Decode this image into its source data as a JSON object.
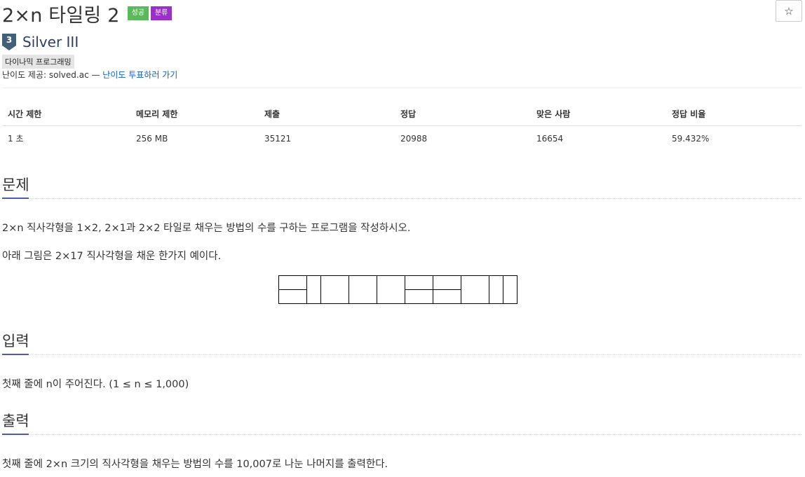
{
  "problem": {
    "title": "2×n 타일링 2",
    "badges": [
      "성공",
      "분류"
    ],
    "tier": "Silver III",
    "tier_number": "3",
    "tag": "다이나믹 프로그래밍",
    "provider_prefix": "난이도 제공: solved.ac — ",
    "provider_link": "난이도 투표하러 가기",
    "star_icon": "☆"
  },
  "stats": {
    "headers": [
      "시간 제한",
      "메모리 제한",
      "제출",
      "정답",
      "맞은 사람",
      "정답 비율"
    ],
    "values": [
      "1 초",
      "256 MB",
      "35121",
      "20988",
      "16654",
      "59.432%"
    ]
  },
  "sections": {
    "problem_heading": "문제",
    "problem_text_1": "2×n 직사각형을 1×2, 2×1과 2×2 타일로 채우는 방법의 수를 구하는 프로그램을 작성하시오.",
    "problem_text_2": "아래 그림은 2×17 직사각형을 채운 한가지 예이다.",
    "input_heading": "입력",
    "input_text": "첫째 줄에 n이 주어진다. (1 ≤ n ≤ 1,000)",
    "output_heading": "출력",
    "output_text": "첫째 줄에 2×n 크기의 직사각형을 채우는 방법의 수를 10,007로 나눈 나머지를 출력한다."
  },
  "colors": {
    "success_badge": "#5cb85c",
    "category_badge": "#9b30c9",
    "tier_color": "#435f7a",
    "link": "#0b61c3",
    "section_accent": "#4c5bb1"
  }
}
